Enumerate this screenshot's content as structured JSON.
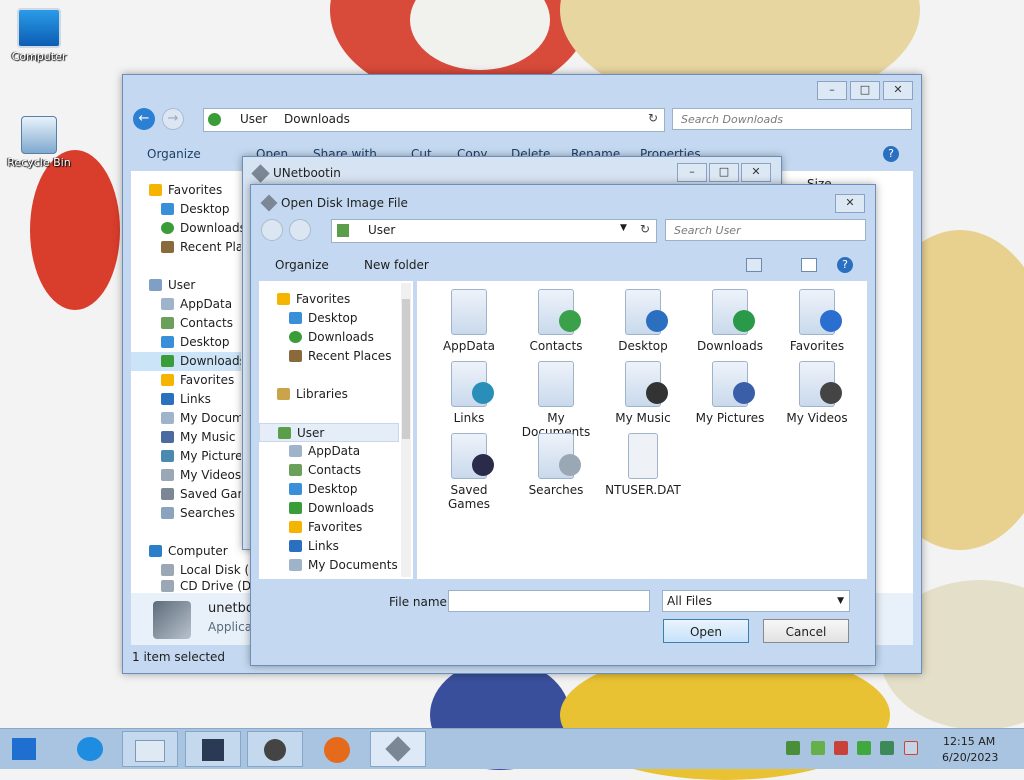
{
  "desktop": {
    "icons": [
      {
        "label": "Computer"
      },
      {
        "label": "Recycle Bin"
      }
    ]
  },
  "explorer": {
    "address": [
      "User",
      "Downloads"
    ],
    "search_placeholder": "Search Downloads",
    "toolbar": [
      "Organize",
      "Open",
      "Share with",
      "Cut",
      "Copy",
      "Delete",
      "Rename",
      "Properties"
    ],
    "column_header": "Size",
    "nav": {
      "favorites": {
        "label": "Favorites",
        "items": [
          "Desktop",
          "Downloads",
          "Recent Places"
        ]
      },
      "user": {
        "label": "User",
        "items": [
          "AppData",
          "Contacts",
          "Desktop",
          "Downloads",
          "Favorites",
          "Links",
          "My Documents",
          "My Music",
          "My Pictures",
          "My Videos",
          "Saved Games",
          "Searches"
        ]
      },
      "computer": {
        "label": "Computer",
        "items": [
          "Local Disk (C:)",
          "CD Drive (D:)"
        ]
      }
    },
    "details": {
      "name": "unetbootin",
      "type": "Application"
    },
    "status": "1 item selected"
  },
  "unetbootin": {
    "title": "UNetbootin"
  },
  "dialog": {
    "title": "Open Disk Image File",
    "address": [
      "User"
    ],
    "search_placeholder": "Search User",
    "toolbar": {
      "organize": "Organize",
      "new_folder": "New folder"
    },
    "nav": {
      "favorites": {
        "label": "Favorites",
        "items": [
          "Desktop",
          "Downloads",
          "Recent Places"
        ]
      },
      "libraries": {
        "label": "Libraries"
      },
      "user": {
        "label": "User",
        "items": [
          "AppData",
          "Contacts",
          "Desktop",
          "Downloads",
          "Favorites",
          "Links",
          "My Documents"
        ]
      }
    },
    "files": [
      "AppData",
      "Contacts",
      "Desktop",
      "Downloads",
      "Favorites",
      "Links",
      "My Documents",
      "My Music",
      "My Pictures",
      "My Videos",
      "Saved Games",
      "Searches",
      "NTUSER.DAT"
    ],
    "file_name_label": "File name:",
    "file_name_value": "",
    "filter": "All Files",
    "open_label": "Open",
    "cancel_label": "Cancel"
  },
  "taskbar": {
    "time": "12:15 AM",
    "date": "6/20/2023"
  }
}
